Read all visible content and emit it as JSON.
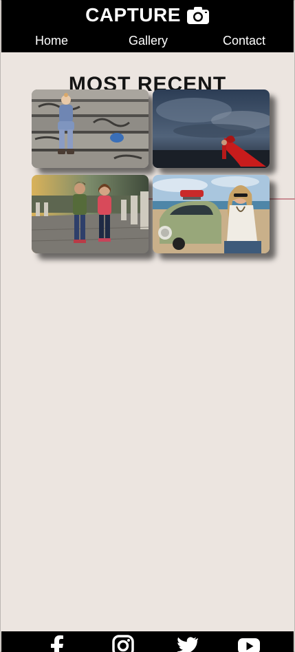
{
  "brand": {
    "title": "CAPTURE",
    "icon": "camera-icon"
  },
  "nav": {
    "items": [
      {
        "label": "Home",
        "active": false
      },
      {
        "label": "Gallery",
        "active": true
      },
      {
        "label": "Contact",
        "active": false
      }
    ]
  },
  "main": {
    "title": "MOST RECENT",
    "photos": [
      {
        "subject": "toddler sitting on graffiti stairs"
      },
      {
        "subject": "woman with red fabric under stormy sky"
      },
      {
        "subject": "two children on cobblestone path"
      },
      {
        "subject": "woman with sunglasses by green vintage car"
      }
    ]
  },
  "footer": {
    "icons": [
      "facebook-icon",
      "instagram-icon",
      "twitter-icon",
      "youtube-icon"
    ]
  },
  "colors": {
    "header_bg": "#000000",
    "page_bg": "#ece5e0",
    "active_underline": "#c98a91"
  }
}
